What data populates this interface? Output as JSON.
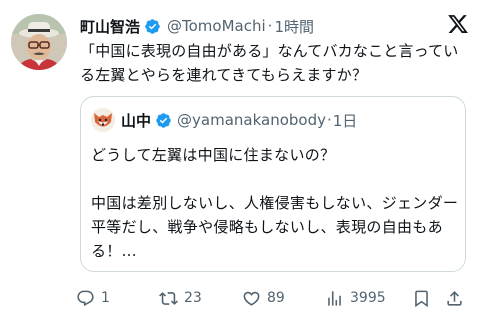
{
  "author": {
    "name": "町山智浩",
    "handle": "@TomoMachi",
    "separator": "·",
    "time": "1時間"
  },
  "tweet": {
    "text": "「中国に表現の自由がある」なんてバカなこと言っている左翼とやらを連れてきてもらえますか？"
  },
  "quoted": {
    "name": "山中",
    "handle": "@yamanakanobody",
    "separator": "·",
    "time": "1日",
    "line1": "どうして左翼は中国に住まないの？",
    "line2": "中国は差別しないし、人権侵害もしない、ジェンダー平等だし、戦争や侵略もしないし、表現の自由もある！..."
  },
  "actions": {
    "replies": "1",
    "retweets": "23",
    "likes": "89",
    "views": "3995"
  },
  "colors": {
    "verified": "#1d9bf0",
    "secondary_text": "#536471",
    "border": "#cfd9de"
  },
  "icons": [
    "verified-badge-icon",
    "x-logo-icon",
    "reply-icon",
    "retweet-icon",
    "like-icon",
    "views-icon",
    "bookmark-icon",
    "share-icon"
  ]
}
